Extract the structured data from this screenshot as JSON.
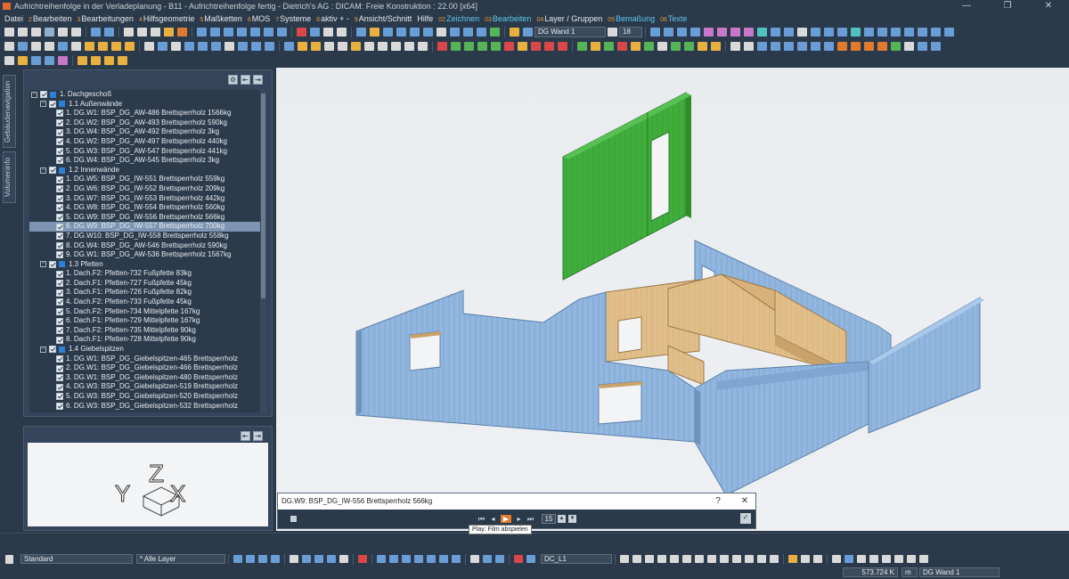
{
  "window": {
    "title": "Aufrichtreihenfolge in der Verladeplanung - B11 - Aufrichtreihenfolge fertig - Dietrich's AG : DICAM: Freie Konstruktion : 22.00 [x64]",
    "controls": [
      "—",
      "❐",
      "✕"
    ]
  },
  "menu": [
    {
      "num": "",
      "label": "Datei",
      "accent": false
    },
    {
      "num": "2",
      "label": "Bearbeiten",
      "accent": false
    },
    {
      "num": "3",
      "label": "Bearbeitungen",
      "accent": false
    },
    {
      "num": "4",
      "label": "Hilfsgeometrie",
      "accent": false
    },
    {
      "num": "5",
      "label": "Maßketten",
      "accent": false
    },
    {
      "num": "6",
      "label": "MOS",
      "accent": false
    },
    {
      "num": "7",
      "label": "Systeme",
      "accent": false
    },
    {
      "num": "8",
      "label": "aktiv + -",
      "accent": false
    },
    {
      "num": "9",
      "label": "Ansicht/Schnitt",
      "accent": false
    },
    {
      "num": "",
      "label": "Hilfe",
      "accent": false
    },
    {
      "num": "02",
      "label": "Zeichnen",
      "accent": true
    },
    {
      "num": "03",
      "label": "Bearbeiten",
      "accent": true
    },
    {
      "num": "04",
      "label": "Layer / Gruppen",
      "accent": false
    },
    {
      "num": "05",
      "label": "Bemaßung",
      "accent": true
    },
    {
      "num": "06",
      "label": "Texte",
      "accent": true
    }
  ],
  "toolbar": {
    "layer_select": "DG Wand 1",
    "size_select": "18"
  },
  "sidetabs": {
    "tab1": "Gebäudenavigation",
    "tab2": "Volumeninfo"
  },
  "panel": {
    "buttons": [
      "⚙",
      "⇤",
      "⇥"
    ],
    "tree": [
      {
        "level": 0,
        "label": "1. Dachgeschoß",
        "type": "group",
        "sq": true
      },
      {
        "level": 1,
        "label": "1.1 Außenwände",
        "type": "group",
        "sq": true
      },
      {
        "level": 2,
        "label": "1. DG.W1: BSP_DG_AW-486 Brettsperrholz 1566kg"
      },
      {
        "level": 2,
        "label": "2. DG.W2: BSP_DG_AW-493 Brettsperrholz 590kg"
      },
      {
        "level": 2,
        "label": "3. DG.W4: BSP_DG_AW-492 Brettsperrholz 3kg"
      },
      {
        "level": 2,
        "label": "4. DG.W2: BSP_DG_AW-497 Brettsperrholz 440kg"
      },
      {
        "level": 2,
        "label": "5. DG.W3: BSP_DG_AW-547 Brettsperrholz 441kg"
      },
      {
        "level": 2,
        "label": "6. DG.W4: BSP_DG_AW-545 Brettsperrholz 3kg"
      },
      {
        "level": 1,
        "label": "1.2 Innenwände",
        "type": "group",
        "sq": true
      },
      {
        "level": 2,
        "label": "1. DG.W5: BSP_DG_IW-551 Brettsperrholz 559kg"
      },
      {
        "level": 2,
        "label": "2. DG.W6: BSP_DG_IW-552 Brettsperrholz 209kg"
      },
      {
        "level": 2,
        "label": "3. DG.W7: BSP_DG_IW-553 Brettsperrholz 442kg"
      },
      {
        "level": 2,
        "label": "4. DG.W8: BSP_DG_IW-554 Brettsperrholz 560kg"
      },
      {
        "level": 2,
        "label": "5. DG.W9: BSP_DG_IW-556 Brettsperrholz 566kg"
      },
      {
        "level": 2,
        "label": "6. DG.W9: BSP_DG_IW-557 Brettsperrholz 700kg",
        "selected": true
      },
      {
        "level": 2,
        "label": "7. DG.W10: BSP_DG_IW-558 Brettsperrholz 558kg"
      },
      {
        "level": 2,
        "label": "8. DG.W4: BSP_DG_AW-546 Brettsperrholz 590kg"
      },
      {
        "level": 2,
        "label": "9. DG.W1: BSP_DG_AW-536 Brettsperrholz 1567kg"
      },
      {
        "level": 1,
        "label": "1.3 Pfetten",
        "type": "group",
        "sq": true
      },
      {
        "level": 2,
        "label": "1. Dach.F2: Pfetten-732 Fußpfette 83kg"
      },
      {
        "level": 2,
        "label": "2. Dach.F1: Pfetten-727 Fußpfette 45kg"
      },
      {
        "level": 2,
        "label": "3. Dach.F1: Pfetten-726 Fußpfette 82kg"
      },
      {
        "level": 2,
        "label": "4. Dach.F2: Pfetten-733 Fußpfette 45kg"
      },
      {
        "level": 2,
        "label": "5. Dach.F2: Pfetten-734 Mittelpfette 167kg"
      },
      {
        "level": 2,
        "label": "6. Dach.F1: Pfetten-729 Mittelpfette 167kg"
      },
      {
        "level": 2,
        "label": "7. Dach.F2: Pfetten-735 Mittelpfette 90kg"
      },
      {
        "level": 2,
        "label": "8. Dach.F1: Pfetten-728 Mittelpfette 90kg"
      },
      {
        "level": 1,
        "label": "1.4 Giebelspitzen",
        "type": "group",
        "sq": true
      },
      {
        "level": 2,
        "label": "1. DG.W1: BSP_DG_Giebelspitzen-465 Brettsperrholz"
      },
      {
        "level": 2,
        "label": "2. DG.W1: BSP_DG_Giebelspitzen-466 Brettsperrholz"
      },
      {
        "level": 2,
        "label": "3. DG.W1: BSP_DG_Giebelspitzen-480 Brettsperrholz"
      },
      {
        "level": 2,
        "label": "4. DG.W3: BSP_DG_Giebelspitzen-519 Brettsperrholz"
      },
      {
        "level": 2,
        "label": "5. DG.W3: BSP_DG_Giebelspitzen-520 Brettsperrholz"
      },
      {
        "level": 2,
        "label": "6. DG.W3: BSP_DG_Giebelspitzen-532 Brettsperrholz"
      }
    ]
  },
  "axes_labels": {
    "y": "Y",
    "z": "Z",
    "x": "X"
  },
  "player": {
    "title": "DG.W9: BSP_DG_IW-556 Brettsperrholz 566kg",
    "help": "?",
    "close": "✕",
    "frame": "15",
    "tooltip": "Play: Film abspielen",
    "controls": [
      "⏮",
      "◂",
      "▶",
      "▸",
      "⏭"
    ]
  },
  "bottom": {
    "standard_select": "Standard",
    "layer_select": "* Alle Layer",
    "dc_select": "DC_L1"
  },
  "status": {
    "coord": "573.724 K",
    "unit": "m",
    "layer": "DG Wand 1"
  },
  "colors": {
    "bg": "#2b3a4a",
    "accent_menu": "#5cc7f0",
    "wall_blue": "#8fb5df",
    "wall_wood": "#e2c08d",
    "wall_green": "#3fae3c",
    "selection": "#7d95b3"
  }
}
